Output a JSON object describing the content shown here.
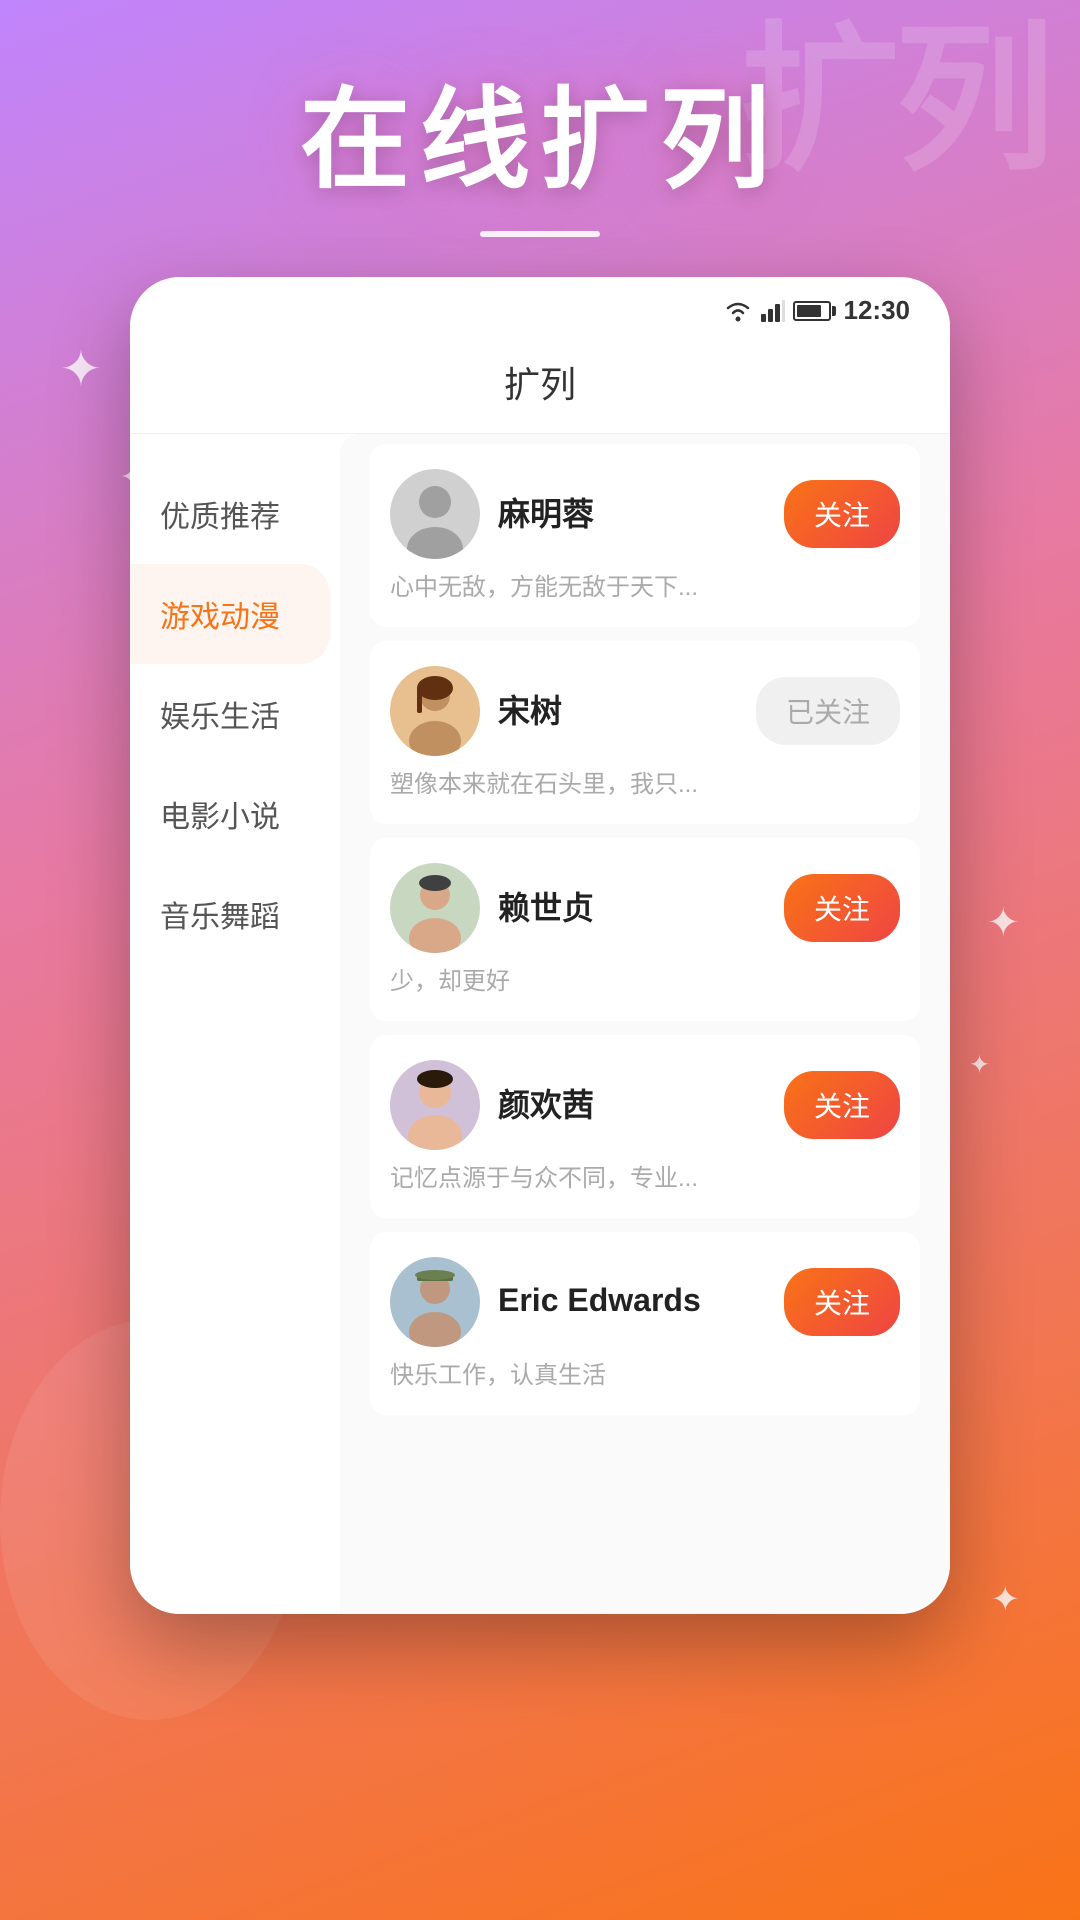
{
  "app": {
    "hero_title": "在线扩列",
    "bg_text": "扩列",
    "divider": true
  },
  "status_bar": {
    "time": "12:30"
  },
  "screen": {
    "title": "扩列"
  },
  "sidebar": {
    "items": [
      {
        "id": "quality",
        "label": "优质推荐",
        "active": false
      },
      {
        "id": "game",
        "label": "游戏动漫",
        "active": true
      },
      {
        "id": "entertainment",
        "label": "娱乐生活",
        "active": false
      },
      {
        "id": "movie",
        "label": "电影小说",
        "active": false
      },
      {
        "id": "music",
        "label": "音乐舞蹈",
        "active": false
      }
    ]
  },
  "users": [
    {
      "id": 1,
      "name": "麻明蓉",
      "desc": "心中无敌，方能无敌于天下...",
      "follow_label": "关注",
      "followed": false,
      "avatar_color": "#c8c8c8"
    },
    {
      "id": 2,
      "name": "宋树",
      "desc": "塑像本来就在石头里，我只...",
      "follow_label": "已关注",
      "followed": true,
      "avatar_color": "#d4a080"
    },
    {
      "id": 3,
      "name": "赖世贞",
      "desc": "少，却更好",
      "follow_label": "关注",
      "followed": false,
      "avatar_color": "#b8c8b0"
    },
    {
      "id": 4,
      "name": "颜欢茜",
      "desc": "记忆点源于与众不同，专业...",
      "follow_label": "关注",
      "followed": false,
      "avatar_color": "#c0b0c0"
    },
    {
      "id": 5,
      "name": "Eric Edwards",
      "desc": "快乐工作，认真生活",
      "follow_label": "关注",
      "followed": false,
      "avatar_color": "#a0b8c8"
    }
  ]
}
